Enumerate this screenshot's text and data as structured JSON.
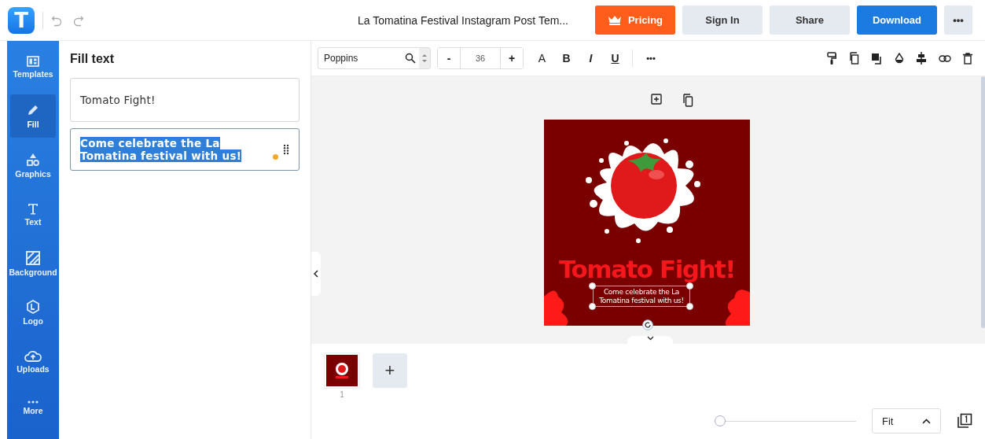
{
  "header": {
    "logo": "T",
    "title": "La Tomatina Festival Instagram Post Tem...",
    "buttons": [
      {
        "label": "Pricing",
        "kind": "pricing"
      },
      {
        "label": "Sign In",
        "kind": "secondary"
      },
      {
        "label": "Share",
        "kind": "secondary"
      },
      {
        "label": "Download",
        "kind": "primary"
      },
      {
        "label": "•••",
        "kind": "more"
      }
    ]
  },
  "sidebar": {
    "items": [
      {
        "label": "Templates",
        "kind": "templates",
        "selected": false
      },
      {
        "label": "Fill",
        "kind": "fill",
        "selected": true
      },
      {
        "label": "Graphics",
        "kind": "graphics",
        "selected": false
      },
      {
        "label": "Text",
        "kind": "text",
        "selected": false
      },
      {
        "label": "Background",
        "kind": "background",
        "selected": false
      },
      {
        "label": "Logo",
        "kind": "logo",
        "selected": false
      },
      {
        "label": "Uploads",
        "kind": "uploads",
        "selected": false
      },
      {
        "label": "More",
        "kind": "more",
        "selected": false
      }
    ]
  },
  "panel": {
    "title": "Fill text",
    "fields": [
      {
        "value": "Tomato Fight!",
        "selected": false
      },
      {
        "value": "Come celebrate the La Tomatina festival with us!",
        "selected": true
      }
    ]
  },
  "toolbar": {
    "font": "Poppins",
    "minus": "-",
    "size": "36",
    "plus": "+",
    "format": [
      {
        "label": "A",
        "kind": "case"
      },
      {
        "label": "B",
        "kind": "bold"
      },
      {
        "label": "I",
        "kind": "italic"
      },
      {
        "label": "U",
        "kind": "underline"
      }
    ],
    "more": "•••"
  },
  "design": {
    "headline": "Tomato Fight!",
    "subtext": "Come celebrate the La Tomatina festival with us!"
  },
  "pages": [
    {
      "number": "1",
      "selected": true
    }
  ],
  "add_page": "+",
  "zoom": {
    "level": 0,
    "mode": "Fit"
  }
}
